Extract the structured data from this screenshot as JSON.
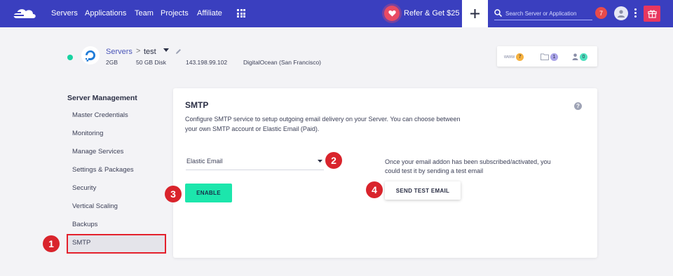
{
  "nav": {
    "links": [
      "Servers",
      "Applications",
      "Team",
      "Projects",
      "Affiliate"
    ],
    "refer_label": "Refer & Get $25",
    "plus_label": "+",
    "search_placeholder": "Search Server or Application",
    "notification_count": "7",
    "colors": {
      "bar": "#3a3fbf",
      "gift": "#e8375f",
      "badge": "#e84b4b"
    }
  },
  "server": {
    "breadcrumb_root": "Servers",
    "breadcrumb_sep": ">",
    "name": "test",
    "ram": "2GB",
    "disk": "50 GB Disk",
    "ip": "143.198.99.102",
    "provider": "DigitalOcean (San Francisco)",
    "status_color": "#18d3a1"
  },
  "stats": {
    "www_label": "www",
    "www_count": "7",
    "files_count": "1",
    "members_count": "0"
  },
  "sidebar": {
    "heading": "Server Management",
    "items": [
      "Master Credentials",
      "Monitoring",
      "Manage Services",
      "Settings & Packages",
      "Security",
      "Vertical Scaling",
      "Backups",
      "SMTP"
    ],
    "active": "SMTP"
  },
  "markers": [
    "1",
    "2",
    "3",
    "4"
  ],
  "smtp": {
    "title": "SMTP",
    "help": "?",
    "description": "Configure SMTP service to setup outgoing email delivery on your Server. You can choose between your own SMTP account or Elastic Email (Paid).",
    "select_value": "Elastic Email",
    "enable_label": "ENABLE",
    "info": "Once your email addon has been subscribed/activated, you could test it by sending a test email",
    "test_label": "SEND TEST EMAIL",
    "colors": {
      "enable": "#1ce6ac",
      "marker": "#d9242c"
    }
  }
}
